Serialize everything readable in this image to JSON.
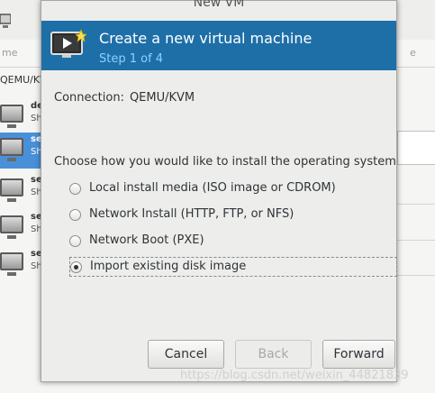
{
  "background": {
    "column_left": "me",
    "column_right": "e",
    "connection": "QEMU/KV",
    "rows": [
      {
        "name": "de",
        "sub": "Sh",
        "selected": false
      },
      {
        "name": "se",
        "sub": "Sh",
        "selected": true
      },
      {
        "name": "se",
        "sub": "Sh",
        "selected": false
      },
      {
        "name": "se",
        "sub": "Sh",
        "selected": false
      },
      {
        "name": "se",
        "sub": "Sh",
        "selected": false
      }
    ]
  },
  "dialog": {
    "window_title": "New VM",
    "header": {
      "title": "Create a new virtual machine",
      "step": "Step 1 of 4"
    },
    "connection_label": "Connection:",
    "connection_value": "QEMU/KVM",
    "install_prompt": "Choose how you would like to install the operating system",
    "options": [
      {
        "label": "Local install media (ISO image or CDROM)",
        "checked": false
      },
      {
        "label": "Network Install (HTTP, FTP, or NFS)",
        "checked": false
      },
      {
        "label": "Network Boot (PXE)",
        "checked": false
      },
      {
        "label": "Import existing disk image",
        "checked": true
      }
    ],
    "buttons": {
      "cancel": "Cancel",
      "back": "Back",
      "forward": "Forward"
    }
  },
  "watermark": "https://blog.csdn.net/weixin_44821839",
  "colors": {
    "banner": "#1e6fa8",
    "step_text": "#8fd0ff",
    "selection": "#4a90d9"
  }
}
